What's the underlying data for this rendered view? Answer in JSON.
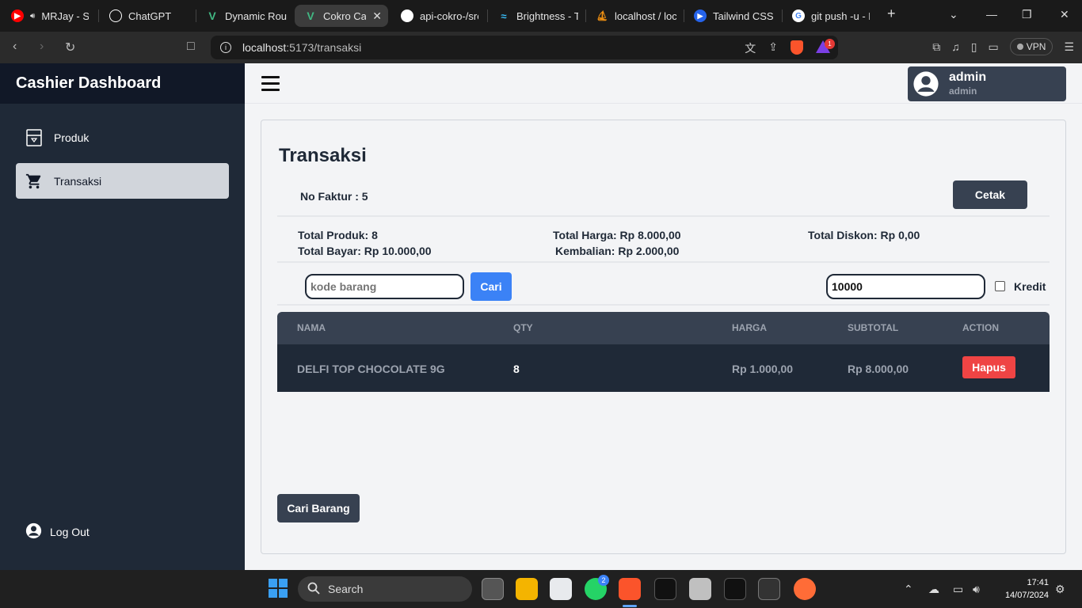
{
  "browser": {
    "tabs": [
      {
        "title": "MRJay - Sp",
        "icon": "youtube-icon",
        "color": "#ff0000"
      },
      {
        "title": "ChatGPT",
        "icon": "chatgpt-icon",
        "color": "#ffffff"
      },
      {
        "title": "Dynamic Route",
        "icon": "vue-icon",
        "color": "#41b883"
      },
      {
        "title": "Cokro Cas",
        "icon": "vue-icon",
        "color": "#41b883"
      },
      {
        "title": "api-cokro-/src/",
        "icon": "github-icon",
        "color": "#ffffff"
      },
      {
        "title": "Brightness - Ta",
        "icon": "tailwind-icon",
        "color": "#38bdf8"
      },
      {
        "title": "localhost / loca",
        "icon": "phpmyadmin-icon",
        "color": "#f29111"
      },
      {
        "title": "Tailwind CSS Lo",
        "icon": "tailwind-icon",
        "color": "#2563eb"
      },
      {
        "title": "git push -u - P",
        "icon": "google-icon",
        "color": "#ffffff"
      }
    ],
    "url_host": "localhost",
    "url_path": ":5173/transaksi",
    "vpn_label": "VPN",
    "rewards_badge": "1"
  },
  "sidebar": {
    "title": "Cashier Dashboard",
    "items": [
      {
        "label": "Produk",
        "icon": "box-icon"
      },
      {
        "label": "Transaksi",
        "icon": "cart-icon"
      }
    ],
    "logout_label": "Log Out"
  },
  "header": {
    "user_name": "admin",
    "user_role": "admin"
  },
  "transaksi": {
    "title": "Transaksi",
    "faktur_label": "No Faktur : 5",
    "print_label": "Cetak",
    "summary": {
      "total_produk": "Total Produk: 8",
      "total_bayar": "Total Bayar: Rp 10.000,00",
      "total_harga": "Total Harga: Rp 8.000,00",
      "kembalian": "Kembalian: Rp 2.000,00",
      "total_diskon": "Total Diskon: Rp 0,00"
    },
    "search_placeholder": "kode barang",
    "search_button": "Cari",
    "payment_value": "10000",
    "kredit_label": "Kredit",
    "table": {
      "headers": [
        "NAMA",
        "QTY",
        "HARGA",
        "SUBTOTAL",
        "ACTION"
      ],
      "rows": [
        {
          "nama": "DELFI TOP CHOCOLATE 9G",
          "qty": "8",
          "harga": "Rp 1.000,00",
          "subtotal": "Rp 8.000,00",
          "action": "Hapus"
        }
      ]
    },
    "find_item_button": "Cari Barang"
  },
  "taskbar": {
    "search_label": "Search",
    "whatsapp_badge": "2",
    "time": "17:41",
    "date": "14/07/2024"
  },
  "colors": {
    "sidebar_bg": "#1f2937",
    "accent_blue": "#3b82f6",
    "danger": "#ef4444",
    "button_dark": "#374151"
  }
}
